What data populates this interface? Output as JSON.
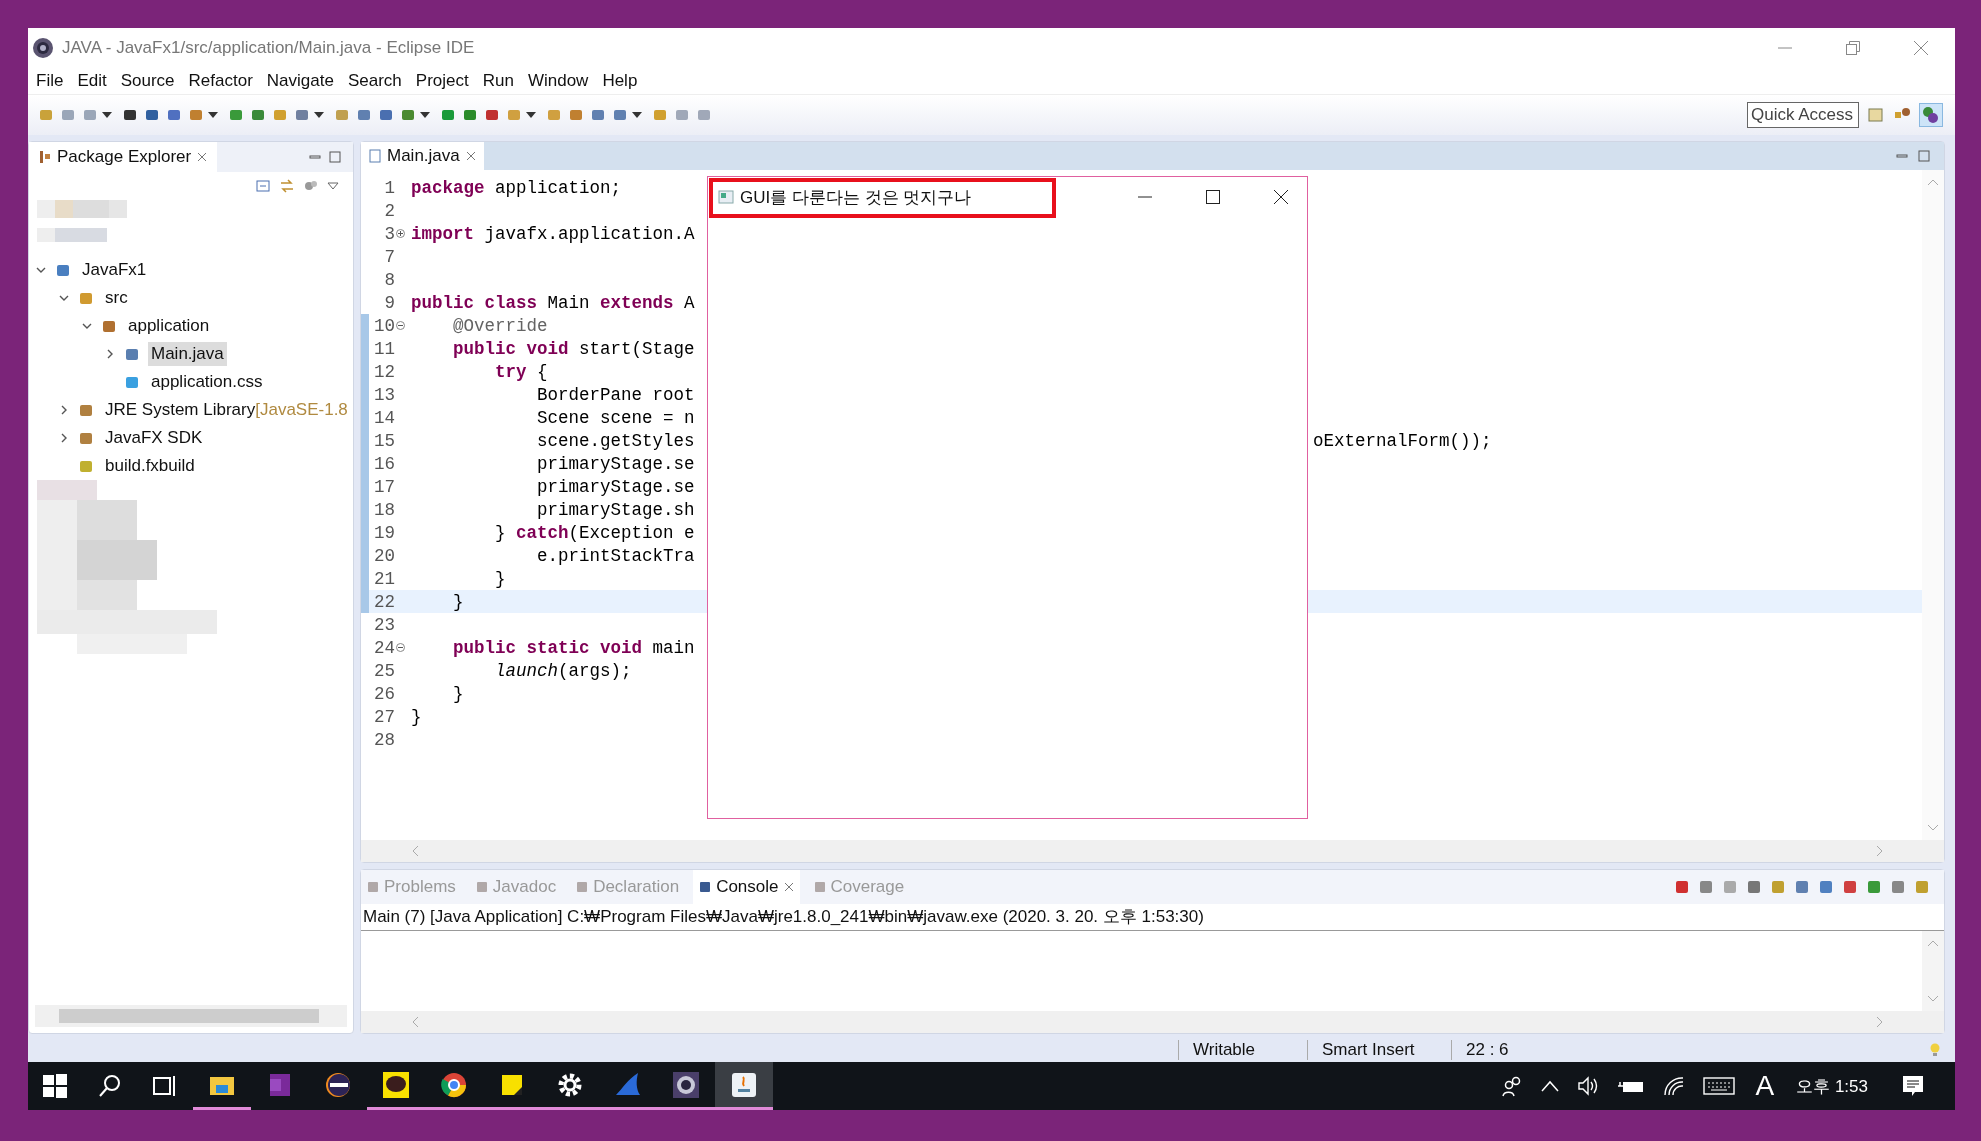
{
  "window": {
    "title": "JAVA - JavaFx1/src/application/Main.java - Eclipse IDE"
  },
  "menu": [
    "File",
    "Edit",
    "Source",
    "Refactor",
    "Navigate",
    "Search",
    "Project",
    "Run",
    "Window",
    "Help"
  ],
  "quick_access": {
    "placeholder": "Quick Access"
  },
  "package_explorer": {
    "title": "Package Explorer",
    "tree": [
      {
        "label": "JavaFx1",
        "kind": "project",
        "expanded": true,
        "selected": false,
        "children": [
          {
            "label": "src",
            "kind": "folder",
            "expanded": true,
            "selected": false,
            "children": [
              {
                "label": "application",
                "kind": "package",
                "expanded": true,
                "selected": false,
                "children": [
                  {
                    "label": "Main.java",
                    "kind": "java",
                    "expanded": false,
                    "selected": true
                  },
                  {
                    "label": "application.css",
                    "kind": "css",
                    "selected": false
                  }
                ]
              }
            ]
          },
          {
            "label": "JRE System Library",
            "suffix": "[JavaSE-1.8",
            "kind": "library",
            "expanded": false,
            "selected": false
          },
          {
            "label": "JavaFX SDK",
            "kind": "library",
            "expanded": false,
            "selected": false
          },
          {
            "label": "build.fxbuild",
            "kind": "build",
            "selected": false
          }
        ]
      }
    ]
  },
  "editor": {
    "tab": "Main.java",
    "lines": [
      {
        "number": "1",
        "code": "**package** application;",
        "current": false
      },
      {
        "number": "2",
        "current": false
      },
      {
        "number": "3",
        "code": "**import** javafx.application.A",
        "collapsed": true,
        "current": false
      },
      {
        "number": "7",
        "current": false
      },
      {
        "number": "8",
        "current": false
      },
      {
        "number": "9",
        "code": "**public** **class** Main **extends** A",
        "current": false
      },
      {
        "number": "10",
        "code": "    @Override",
        "kind": "annotation",
        "collapsed": false,
        "current": false
      },
      {
        "number": "11",
        "code": "    **public** **void** start(Stage",
        "current": false
      },
      {
        "number": "12",
        "code": "        **try** {",
        "current": false
      },
      {
        "number": "13",
        "code": "            BorderPane root",
        "current": false
      },
      {
        "number": "14",
        "code": "            Scene scene = n",
        "current": false
      },
      {
        "number": "15",
        "code": "            scene.getStyles",
        "tail": "oExternalForm());",
        "current": false
      },
      {
        "number": "16",
        "code": "            primaryStage.se",
        "current": false
      },
      {
        "number": "17",
        "code": "            primaryStage.se",
        "current": false
      },
      {
        "number": "18",
        "code": "            primaryStage.sh",
        "current": false
      },
      {
        "number": "19",
        "code": "        } **catch**(Exception e",
        "current": false
      },
      {
        "number": "20",
        "code": "            e.printStackTra",
        "current": false
      },
      {
        "number": "21",
        "code": "        }",
        "current": false
      },
      {
        "number": "22",
        "code": "    }",
        "current": true
      },
      {
        "number": "23",
        "current": false
      },
      {
        "number": "24",
        "code": "    **public** **static** **void** main",
        "collapsed": false,
        "current": false
      },
      {
        "number": "25",
        "code": "        *launch*(args);",
        "current": false
      },
      {
        "number": "26",
        "code": "    }",
        "current": false
      },
      {
        "number": "27",
        "code": "}",
        "current": false
      },
      {
        "number": "28",
        "current": false
      }
    ]
  },
  "dialog": {
    "title": "GUI를 다룬다는 것은 멋지구나",
    "highlighted": true
  },
  "bottom_panel": {
    "tabs": [
      {
        "label": "Problems",
        "selected": false
      },
      {
        "label": "Javadoc",
        "selected": false
      },
      {
        "label": "Declaration",
        "selected": false
      },
      {
        "label": "Console",
        "selected": true
      },
      {
        "label": "Coverage",
        "selected": false
      }
    ],
    "console_line": "Main (7) [Java Application] C:₩Program Files₩Java₩jre1.8.0_241₩bin₩javaw.exe (2020. 3. 20. 오후 1:53:30)"
  },
  "status_bar": [
    "Writable",
    "Smart Insert",
    "22 : 6"
  ],
  "taskbar": {
    "apps": [
      {
        "kind": "folder",
        "running": true,
        "selected": false
      },
      {
        "kind": "notebook",
        "running": false,
        "selected": false
      },
      {
        "kind": "eclipse",
        "running": false,
        "selected": false
      },
      {
        "kind": "chat",
        "running": true,
        "selected": false
      },
      {
        "kind": "browser",
        "running": true,
        "selected": false
      },
      {
        "kind": "note",
        "running": true,
        "selected": false
      },
      {
        "kind": "gear",
        "running": true,
        "selected": false
      },
      {
        "kind": "fin",
        "running": true,
        "selected": false
      },
      {
        "kind": "eclipse-gear",
        "running": true,
        "selected": false
      },
      {
        "kind": "java",
        "running": true,
        "selected": true
      }
    ],
    "ime": "A",
    "clock": "오후 1:53"
  }
}
